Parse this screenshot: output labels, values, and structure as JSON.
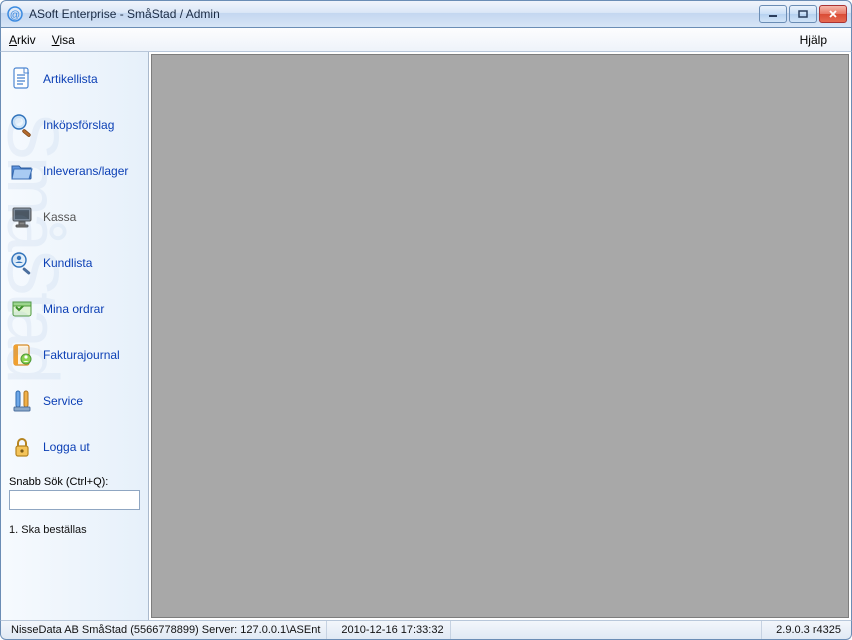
{
  "window": {
    "title": "ASoft Enterprise - SmåStad / Admin"
  },
  "menubar": {
    "arkiv": "Arkiv",
    "visa": "Visa",
    "hjalp": "Hjälp"
  },
  "sidebar": {
    "items": [
      {
        "label": "Artikellista",
        "icon": "document-list-icon",
        "link": true
      },
      {
        "label": "Inköpsförslag",
        "icon": "magnifier-icon",
        "link": true
      },
      {
        "label": "Inleverans/lager",
        "icon": "folder-open-icon",
        "link": true
      },
      {
        "label": "Kassa",
        "icon": "monitor-icon",
        "link": false
      },
      {
        "label": "Kundlista",
        "icon": "search-person-icon",
        "link": true
      },
      {
        "label": "Mina ordrar",
        "icon": "orders-icon",
        "link": true
      },
      {
        "label": "Fakturajournal",
        "icon": "invoice-journal-icon",
        "link": true
      },
      {
        "label": "Service",
        "icon": "wrench-icon",
        "link": true
      },
      {
        "label": "Logga ut",
        "icon": "lock-icon",
        "link": true
      }
    ],
    "search_label": "Snabb Sök (Ctrl+Q):",
    "search_value": "",
    "note": "1. Ska beställas"
  },
  "statusbar": {
    "company_server": "NisseData AB SmåStad (5566778899) Server: 127.0.0.1\\ASEnt",
    "datetime": "2010-12-16 17:33:32",
    "version": "2.9.0.3 r4325"
  },
  "icons": {
    "document-list-icon": "#3b8ae0",
    "magnifier-icon": "#4b9ed8",
    "folder-open-icon": "#3b75c9",
    "monitor-icon": "#888888",
    "search-person-icon": "#4690d6",
    "orders-icon": "#6fbf4a",
    "invoice-journal-icon": "#f0a030",
    "wrench-icon": "#5a8fd0",
    "lock-icon": "#e6a02c"
  }
}
